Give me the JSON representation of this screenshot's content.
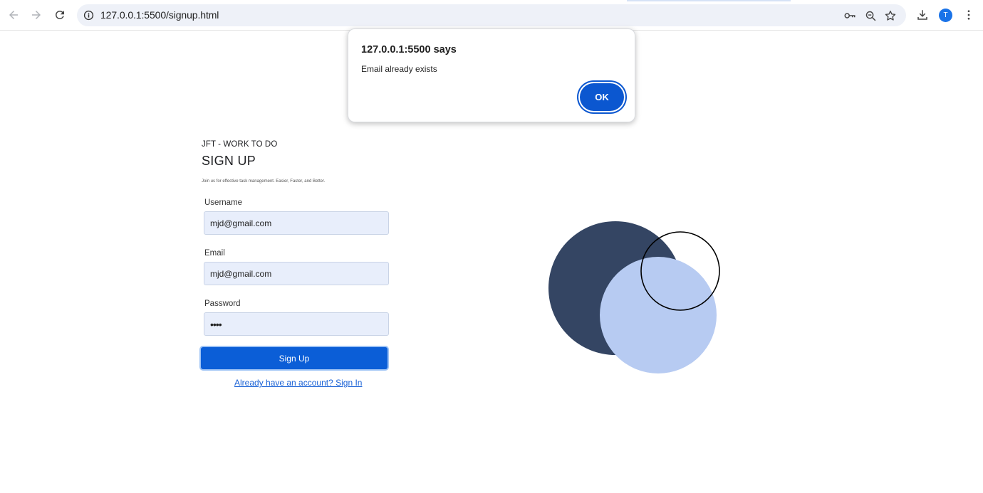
{
  "browser": {
    "url": "127.0.0.1:5500/signup.html",
    "profile_initial": "T",
    "icons": [
      "back-icon",
      "forward-icon",
      "reload-icon",
      "site-info-icon",
      "password-key-icon",
      "zoom-out-icon",
      "bookmark-star-icon",
      "download-icon",
      "menu-dots-icon"
    ]
  },
  "dialog": {
    "origin": "127.0.0.1:5500 says",
    "message": "Email already exists",
    "ok_label": "OK"
  },
  "page": {
    "brand": "JFT - WORK TO DO",
    "title": "SIGN UP",
    "tagline": "Join us for effective task management. Easier, Faster, and Better.",
    "form": {
      "username_label": "Username",
      "username_value": "mjd@gmail.com",
      "email_label": "Email",
      "email_value": "mjd@gmail.com",
      "password_label": "Password",
      "password_value": "••••",
      "submit_label": "Sign Up",
      "signin_link": "Already have an account? Sign In"
    }
  },
  "colors": {
    "accent": "#0b5ed7",
    "dark_circle": "#344563",
    "light_circle": "#b7cbf2",
    "field_bg": "#e8eefb"
  }
}
